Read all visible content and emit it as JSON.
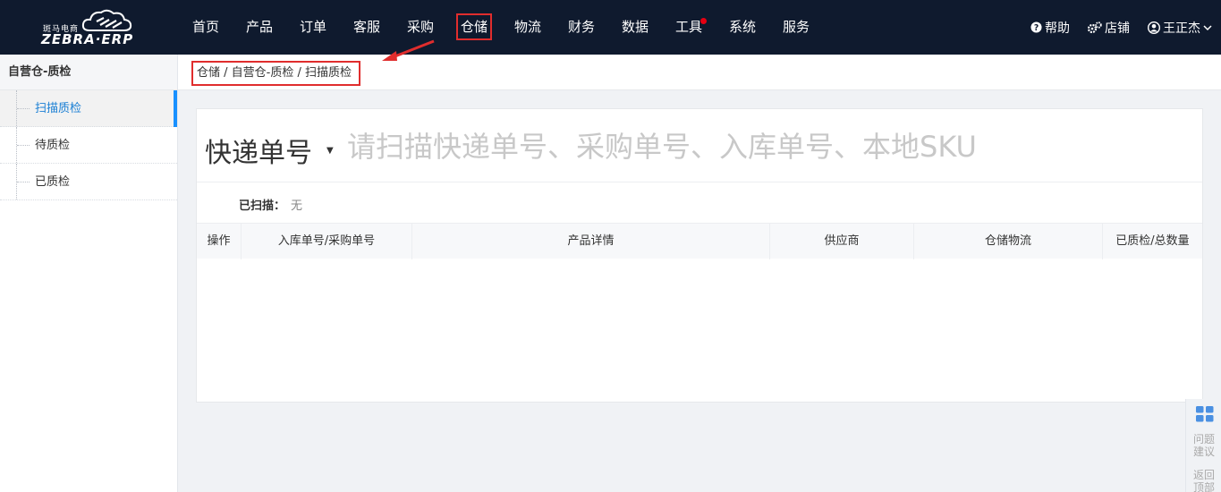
{
  "brand": {
    "cn": "斑马电商",
    "en": "ZEBRA·ERP"
  },
  "nav": [
    {
      "label": "首页"
    },
    {
      "label": "产品"
    },
    {
      "label": "订单"
    },
    {
      "label": "客服"
    },
    {
      "label": "采购"
    },
    {
      "label": "仓储",
      "active": true
    },
    {
      "label": "物流"
    },
    {
      "label": "财务"
    },
    {
      "label": "数据"
    },
    {
      "label": "工具",
      "badge": true
    },
    {
      "label": "系统"
    },
    {
      "label": "服务"
    }
  ],
  "tools": {
    "help": "帮助",
    "shop": "店铺",
    "user": "王正杰"
  },
  "sidebar": {
    "title": "自营仓-质检",
    "items": [
      {
        "label": "扫描质检",
        "active": true
      },
      {
        "label": "待质检"
      },
      {
        "label": "已质检"
      }
    ]
  },
  "breadcrumb": "仓储 / 自营仓-质检 / 扫描质检",
  "scan": {
    "type": "快递单号",
    "placeholder": "请扫描快递单号、采购单号、入库单号、本地SKU"
  },
  "scanned": {
    "label": "已扫描：",
    "value": "无"
  },
  "table": {
    "columns": [
      "操作",
      "入库单号/采购单号",
      "产品详情",
      "供应商",
      "仓储物流",
      "已质检/总数量"
    ]
  },
  "float": {
    "feedback": "问题建议",
    "top": "返回顶部"
  },
  "colors": {
    "topbar": "#0f1a2e",
    "accent": "#1890ff",
    "highlight": "#e02d2d"
  }
}
